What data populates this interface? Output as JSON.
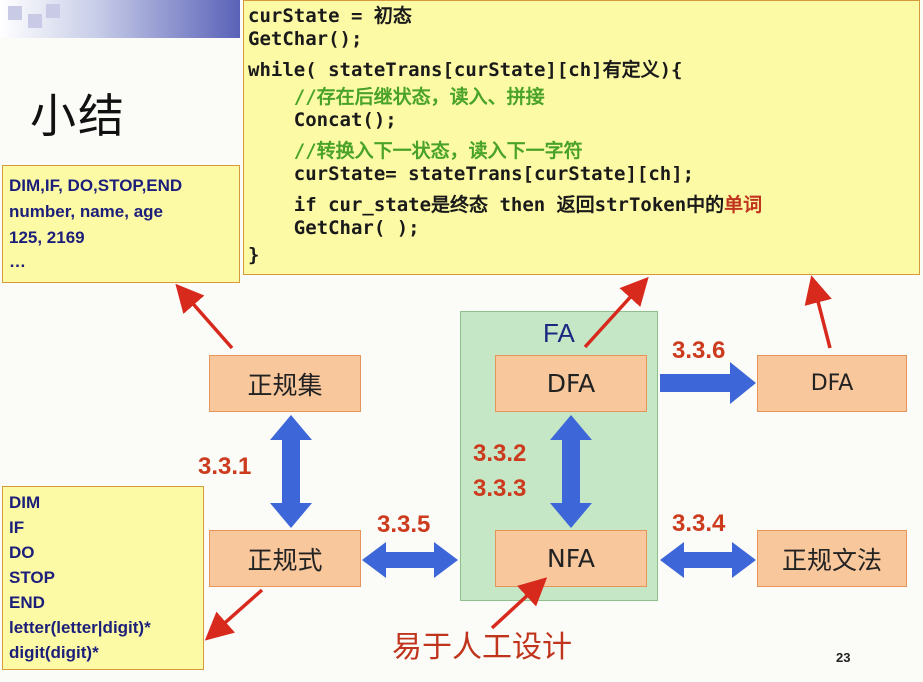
{
  "title": "小结",
  "code_lines": [
    {
      "parts": [
        {
          "t": "curState = 初态",
          "c": ""
        }
      ]
    },
    {
      "parts": [
        {
          "t": "GetChar();",
          "c": ""
        }
      ]
    },
    {
      "parts": [
        {
          "t": "while( stateTrans[curState][ch]有定义){",
          "c": ""
        }
      ]
    },
    {
      "parts": [
        {
          "t": "    //存在后继状态，读入、拼接",
          "c": "comment"
        }
      ]
    },
    {
      "parts": [
        {
          "t": "    Concat();",
          "c": ""
        }
      ]
    },
    {
      "parts": [
        {
          "t": "    //转换入下一状态，读入下一字符",
          "c": "comment"
        }
      ]
    },
    {
      "parts": [
        {
          "t": "    curState= stateTrans[curState][ch];",
          "c": ""
        }
      ]
    },
    {
      "parts": [
        {
          "t": "    if cur_state是终态 then 返回strToken中的",
          "c": ""
        },
        {
          "t": "单词",
          "c": "red"
        }
      ]
    },
    {
      "parts": [
        {
          "t": "    GetChar( );",
          "c": ""
        }
      ]
    },
    {
      "parts": [
        {
          "t": "}",
          "c": ""
        }
      ]
    }
  ],
  "examples_top": [
    "DIM,IF, DO,STOP,END",
    "number, name, age",
    "125, 2169",
    "…"
  ],
  "examples_bottom": [
    "DIM",
    "IF",
    "DO",
    "STOP",
    "END",
    "letter(letter|digit)*",
    "digit(digit)*"
  ],
  "nodes": {
    "regular_set": "正规集",
    "regular_expr": "正规式",
    "dfa": "DFA",
    "nfa": "NFA",
    "dfa_right": "DFA",
    "regular_grammar": "正规文法"
  },
  "fa_label": "FA",
  "section_labels": {
    "s331": "3.3.1",
    "s332": "3.3.2",
    "s333": "3.3.3",
    "s334": "3.3.4",
    "s335": "3.3.5",
    "s336": "3.3.6"
  },
  "design_note": "易于人工设计",
  "page_number": "23",
  "colors": {
    "node_fill": "#f8c79c",
    "code_bg": "#fdfaa6",
    "fa_bg": "#c6e7c6",
    "blue_arrow": "#3d66d8",
    "red_arrow": "#d8291d"
  }
}
